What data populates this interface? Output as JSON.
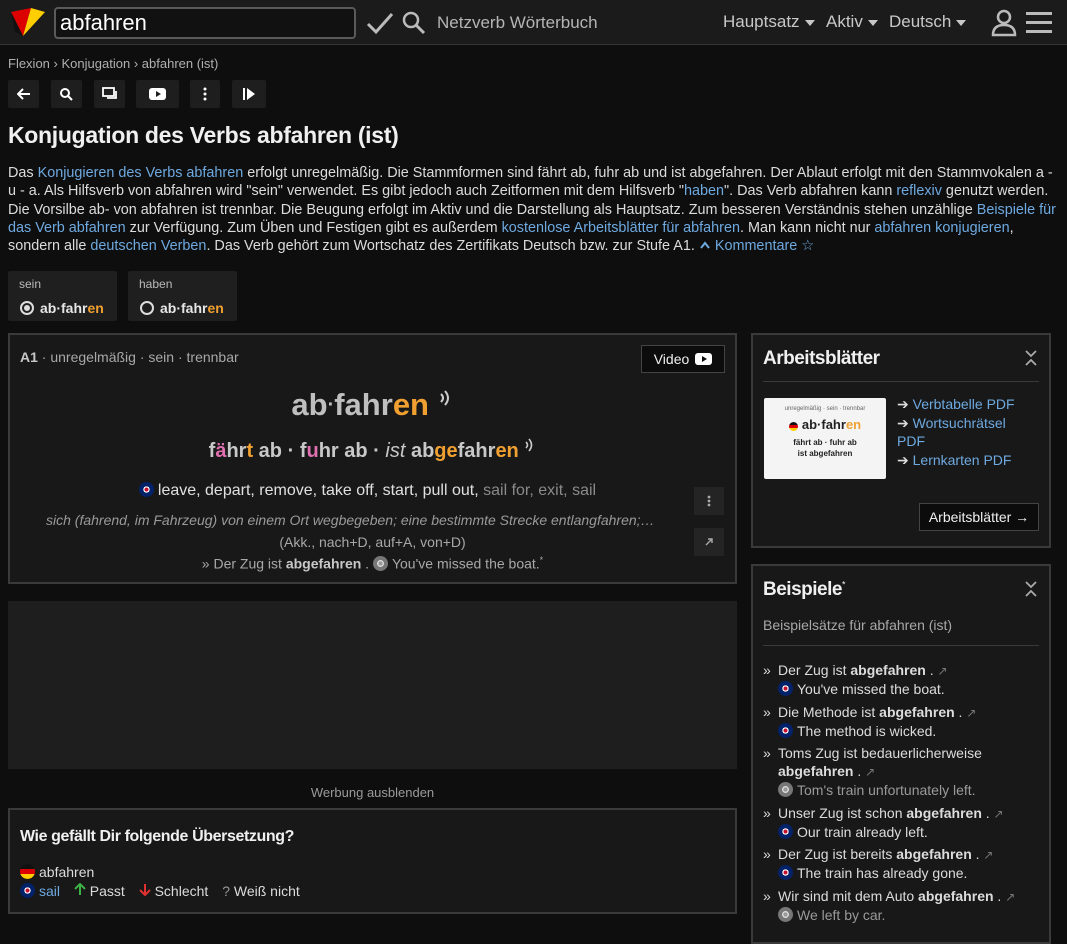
{
  "header": {
    "search_value": "abfahren",
    "brand": "Netzverb Wörterbuch",
    "menus": [
      "Hauptsatz",
      "Aktiv",
      "Deutsch"
    ]
  },
  "breadcrumb": {
    "items": [
      "Flexion",
      "Konjugation",
      "abfahren (ist)"
    ],
    "sep": "›"
  },
  "toolbar": {
    "icons": [
      "back-arrow-icon",
      "search-icon",
      "chat-icon",
      "youtube-icon",
      "more-vertical-icon",
      "play-icon"
    ]
  },
  "title": "Konjugation des Verbs abfahren (ist)",
  "intro": {
    "p1": "Das ",
    "l1": "Konjugieren des Verbs abfahren",
    "p2": " erfolgt unregelmäßig. Die Stammformen sind fährt ab, fuhr ab und ist abgefahren. Der Ablaut erfolgt mit den Stammvokalen a - u - a. Als Hilfsverb von abfahren wird \"sein\" verwendet. Es gibt jedoch auch Zeitformen mit dem Hilfsverb \"",
    "l2": "haben",
    "p3": "\". Das Verb abfahren kann ",
    "l3": "reflexiv",
    "p4": " genutzt werden. Die Vorsilbe ab- von abfahren ist trennbar. Die Beugung erfolgt im Aktiv und die Darstellung als Hauptsatz. Zum besseren Verständnis stehen unzählige ",
    "l4": "Beispiele für das Verb abfahren",
    "p5": " zur Verfügung. Zum Üben und Festigen gibt es außerdem ",
    "l5": "kostenlose Arbeitsblätter für abfahren",
    "p6": ". Man kann nicht nur ",
    "l6": "abfahren konjugieren",
    "p7": ", sondern alle ",
    "l7": "deutschen Verben",
    "p8": ". Das Verb gehört zum Wortschatz des Zertifikats Deutsch bzw. zur Stufe A1. ",
    "l8": "Kommentare ☆"
  },
  "aux": [
    {
      "label": "sein",
      "verb_a": "ab·fahr",
      "verb_b": "en",
      "selected": true
    },
    {
      "label": "haben",
      "verb_a": "ab·fahr",
      "verb_b": "en",
      "selected": false
    }
  ],
  "verb_card": {
    "level": "A1",
    "tags": "· unregelmäßig · sein · trennbar",
    "video_label": "Video",
    "headword": {
      "prefix": "ab",
      "dot": "·",
      "stem": "fahr",
      "ending": "en"
    },
    "forms": {
      "f1a": "f",
      "f1b": "ä",
      "f1c": "hr",
      "f1d": "t",
      "f1e": " ab",
      "sep": " · ",
      "f2a": "f",
      "f2b": "u",
      "f2c": "hr ab",
      "f3aux": "ist",
      "f3a": "ab",
      "f3b": "ge",
      "f3c": "fahr",
      "f3d": "en"
    },
    "translations": "leave, depart, remove, take off, start, pull out,",
    "translations_dim": [
      "sail for",
      "exit",
      "sail"
    ],
    "definition": "sich (fahrend, im Fahrzeug) von einem Ort wegbegeben; eine bestimmte Strecke entlangfahren;…",
    "valency": "(Akk., nach+D, auf+A, von+D)",
    "example_de_pre": "» Der Zug ist ",
    "example_de_bold": "abgefahren",
    "example_de_post": " .",
    "example_en": "You've missed the boat.",
    "example_mark": "*"
  },
  "ad": {
    "hide_label": "Werbung ausblenden"
  },
  "feedback": {
    "title": "Wie gefällt Dir folgende Übersetzung?",
    "source": "abfahren",
    "target": "sail",
    "opt_good": "Passt",
    "opt_bad": "Schlecht",
    "opt_unknown": "Weiß nicht"
  },
  "worksheets": {
    "title": "Arbeitsblätter",
    "links": [
      "Verbtabelle PDF",
      "Wortsuchrätsel PDF",
      "Lernkarten PDF"
    ],
    "thumb_title": "unregelmäßig · sein · trennbar",
    "thumb_word_a": "ab·fahr",
    "thumb_word_b": "en",
    "thumb_forms_1": "fährt ab · fuhr ab",
    "thumb_forms_2": "ist abgefahren",
    "button": "Arbeitsblätter →"
  },
  "examples": {
    "title": "Beispiele",
    "title_mark": "*",
    "subtitle": "Beispielsätze für abfahren (ist)",
    "items": [
      {
        "pre": "Der Zug ist ",
        "bold_a": "ab",
        "bold_b": "ge",
        "bold_c": "fahr",
        "bold_d": "en",
        "post": " .",
        "en": "You've missed the boat.",
        "grey": false
      },
      {
        "pre": "Die Methode ist ",
        "bold_a": "ab",
        "bold_b": "ge",
        "bold_c": "fahr",
        "bold_d": "en",
        "post": " .",
        "en": "The method is wicked.",
        "grey": false
      },
      {
        "pre": "Toms Zug ist bedauerlicherweise ",
        "bold_a": "ab",
        "bold_b": "ge",
        "bold_c": "fahr",
        "bold_d": "en",
        "post": " .",
        "en": "Tom's train unfortunately left.",
        "grey": true
      },
      {
        "pre": "Unser Zug ist schon ",
        "bold_a": "ab",
        "bold_b": "ge",
        "bold_c": "fahr",
        "bold_d": "en",
        "post": " .",
        "en": "Our train already left.",
        "grey": false
      },
      {
        "pre": "Der Zug ist bereits ",
        "bold_a": "ab",
        "bold_b": "ge",
        "bold_c": "fahr",
        "bold_d": "en",
        "post": " .",
        "en": "The train has already gone.",
        "grey": false
      },
      {
        "pre": "Wir sind mit dem Auto ",
        "bold_a": "ab",
        "bold_b": "ge",
        "bold_c": "fahr",
        "bold_d": "en",
        "post": " .",
        "en": "We left by car.",
        "grey": true
      }
    ]
  },
  "colors": {
    "accent_orange": "#f0a030",
    "accent_pink": "#e070b0",
    "link_blue": "#6ea9e0",
    "background": "#0e0e0e"
  }
}
